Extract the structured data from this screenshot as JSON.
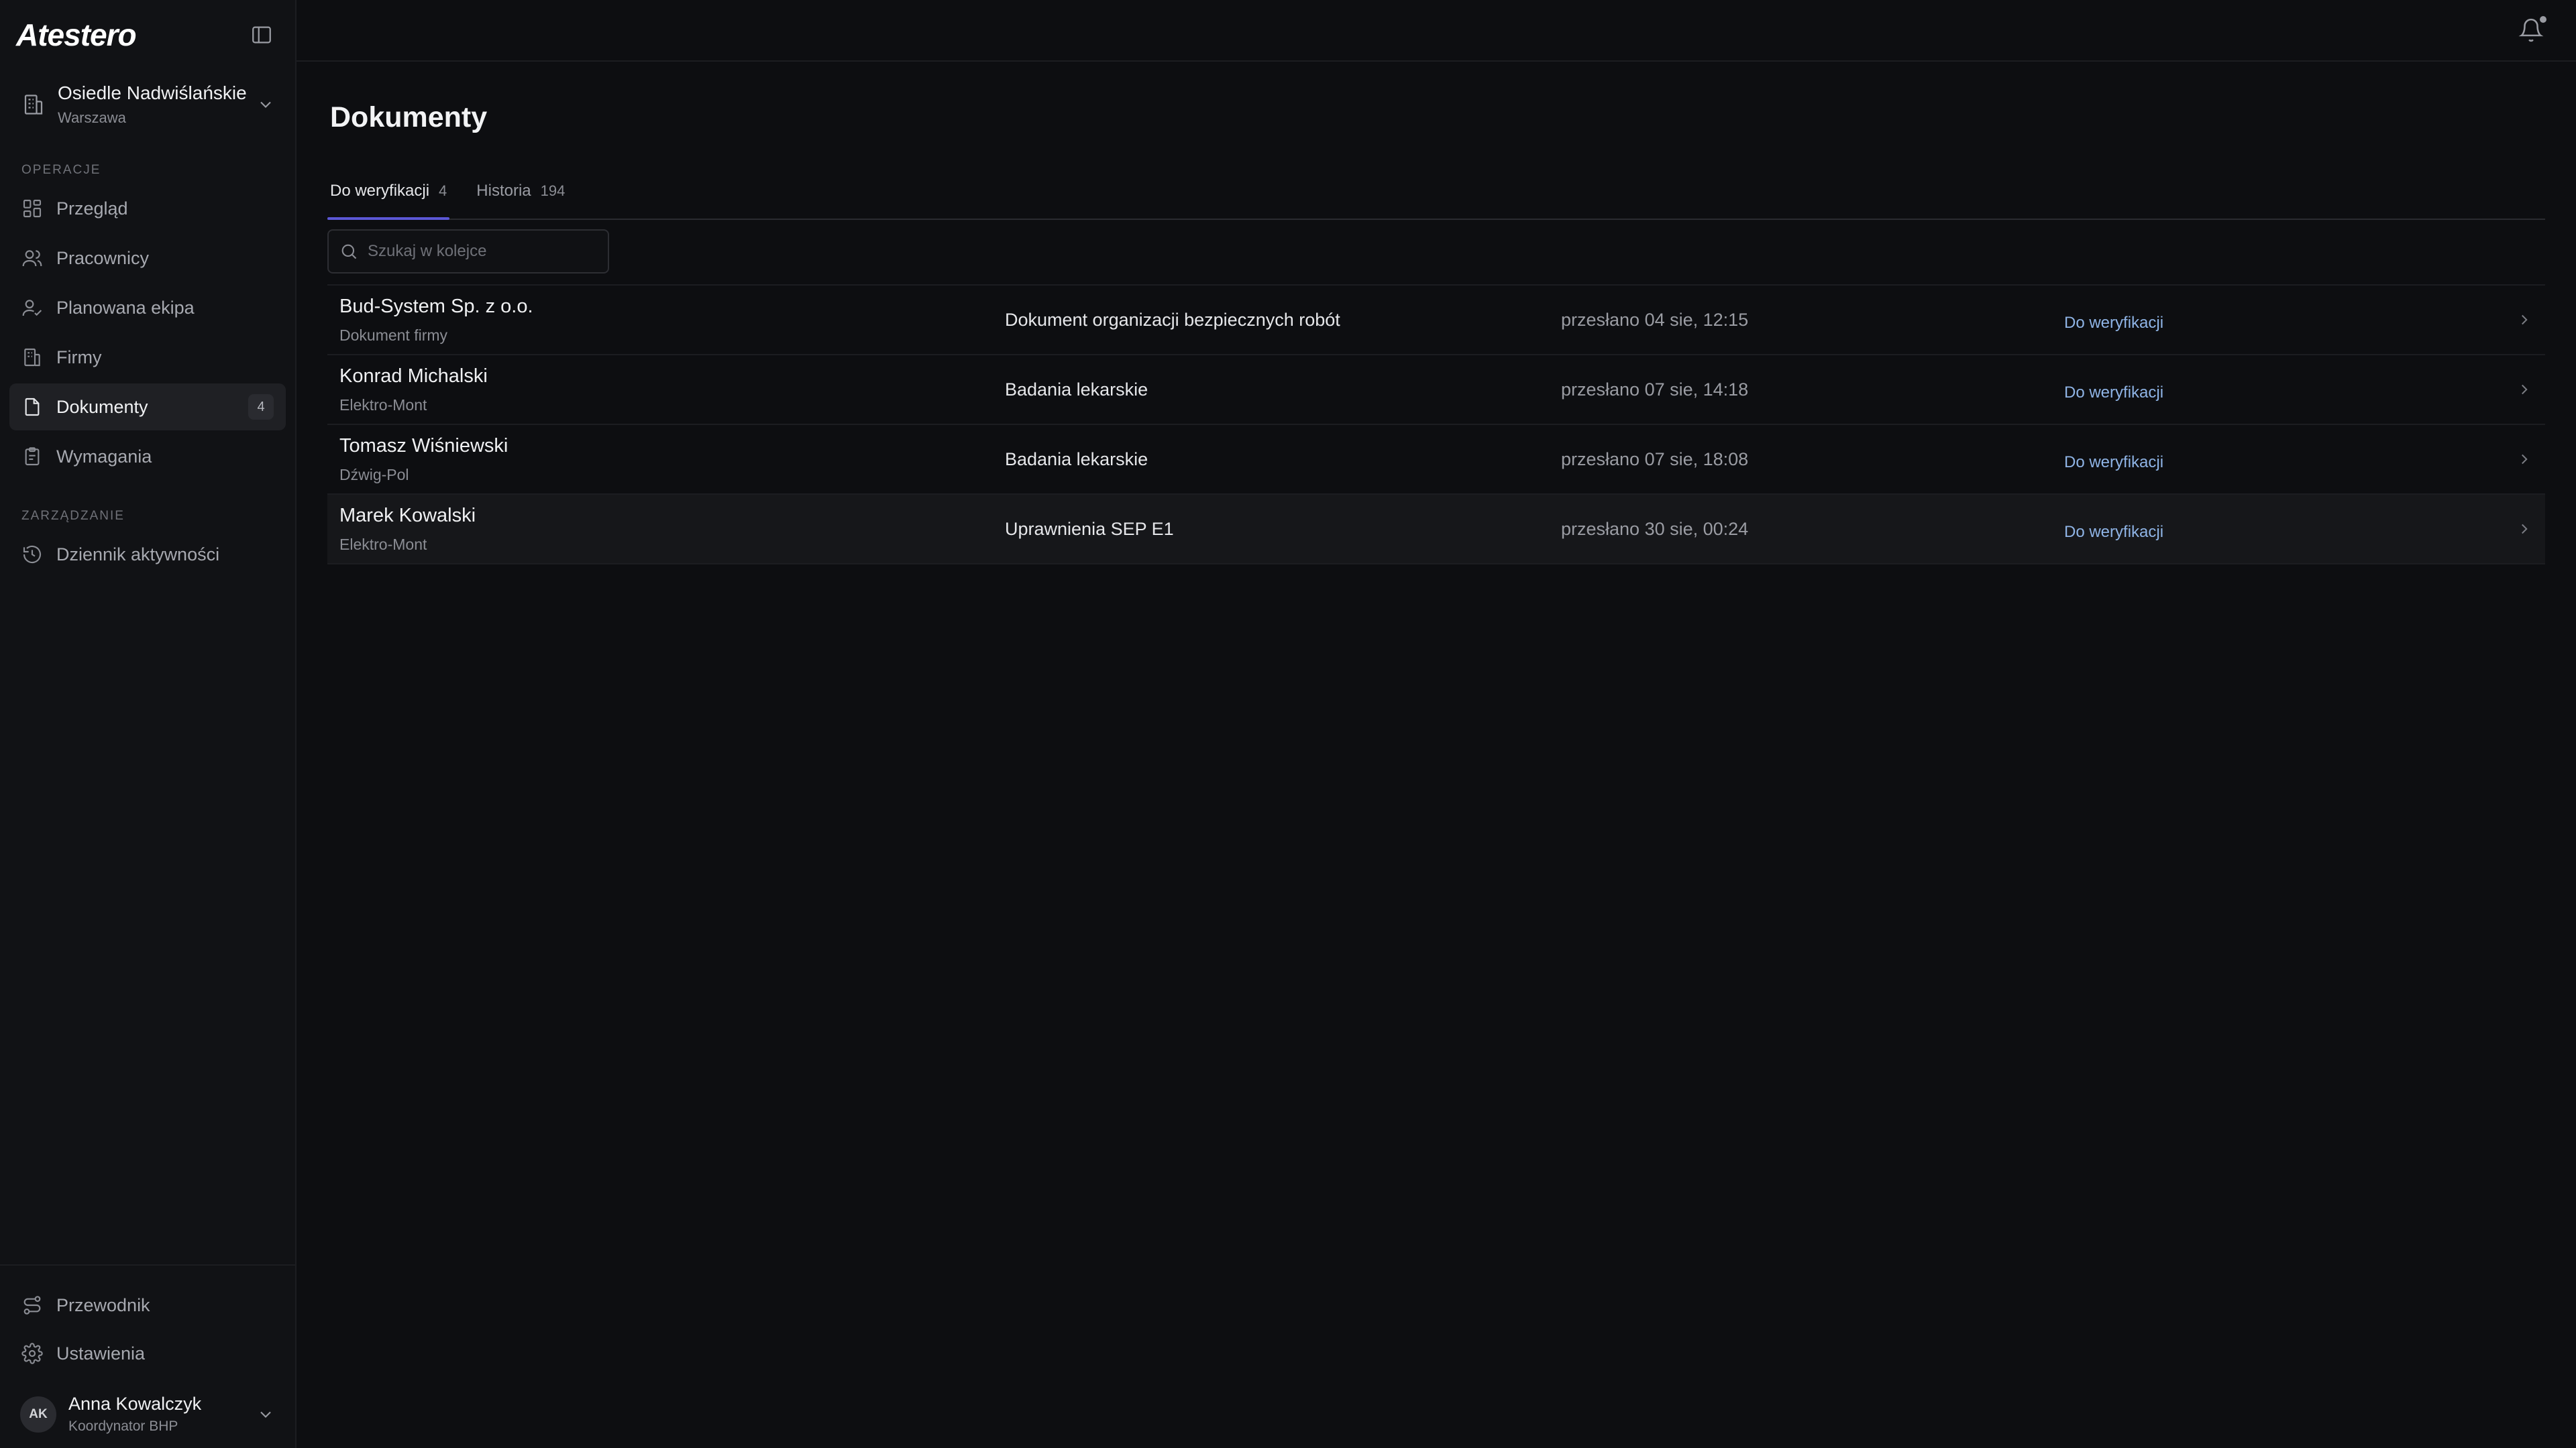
{
  "app": {
    "logo": "Atestero"
  },
  "site": {
    "name": "Osiedle Nadwiślańskie",
    "city": "Warszawa"
  },
  "sidebar": {
    "sections": [
      {
        "label": "OPERACJE"
      },
      {
        "label": "ZARZĄDZANIE"
      }
    ],
    "items": [
      {
        "label": "Przegląd",
        "icon": "grid-icon"
      },
      {
        "label": "Pracownicy",
        "icon": "users-icon"
      },
      {
        "label": "Planowana ekipa",
        "icon": "user-check-icon"
      },
      {
        "label": "Firmy",
        "icon": "building-icon"
      },
      {
        "label": "Dokumenty",
        "icon": "file-icon",
        "count": "4",
        "active": true
      },
      {
        "label": "Wymagania",
        "icon": "clipboard-icon"
      },
      {
        "label": "Dziennik aktywności",
        "icon": "history-icon"
      }
    ],
    "bottom": [
      {
        "label": "Przewodnik",
        "icon": "route-icon"
      },
      {
        "label": "Ustawienia",
        "icon": "gear-icon"
      }
    ]
  },
  "user": {
    "initials": "AK",
    "name": "Anna Kowalczyk",
    "role": "Koordynator BHP"
  },
  "page": {
    "title": "Dokumenty"
  },
  "tabs": [
    {
      "label": "Do weryfikacji",
      "count": "4",
      "active": true
    },
    {
      "label": "Historia",
      "count": "194"
    }
  ],
  "search": {
    "placeholder": "Szukaj w kolejce",
    "value": ""
  },
  "rows": [
    {
      "name": "Bud-System Sp. z o.o.",
      "sub": "Dokument firmy",
      "doc": "Dokument organizacji bezpiecznych robót",
      "sent": "przesłano 04 sie, 12:15",
      "status": "Do weryfikacji"
    },
    {
      "name": "Konrad Michalski",
      "sub": "Elektro-Mont",
      "doc": "Badania lekarskie",
      "sent": "przesłano 07 sie, 14:18",
      "status": "Do weryfikacji"
    },
    {
      "name": "Tomasz Wiśniewski",
      "sub": "Dźwig-Pol",
      "doc": "Badania lekarskie",
      "sent": "przesłano 07 sie, 18:08",
      "status": "Do weryfikacji"
    },
    {
      "name": "Marek Kowalski",
      "sub": "Elektro-Mont",
      "doc": "Uprawnienia SEP E1",
      "sent": "przesłano 30 sie, 00:24",
      "status": "Do weryfikacji",
      "highlight": true
    }
  ],
  "colors": {
    "accent": "#5b57d6",
    "status": "#8fb4e6",
    "background": "#0d0e11",
    "sidebar": "#111215"
  }
}
